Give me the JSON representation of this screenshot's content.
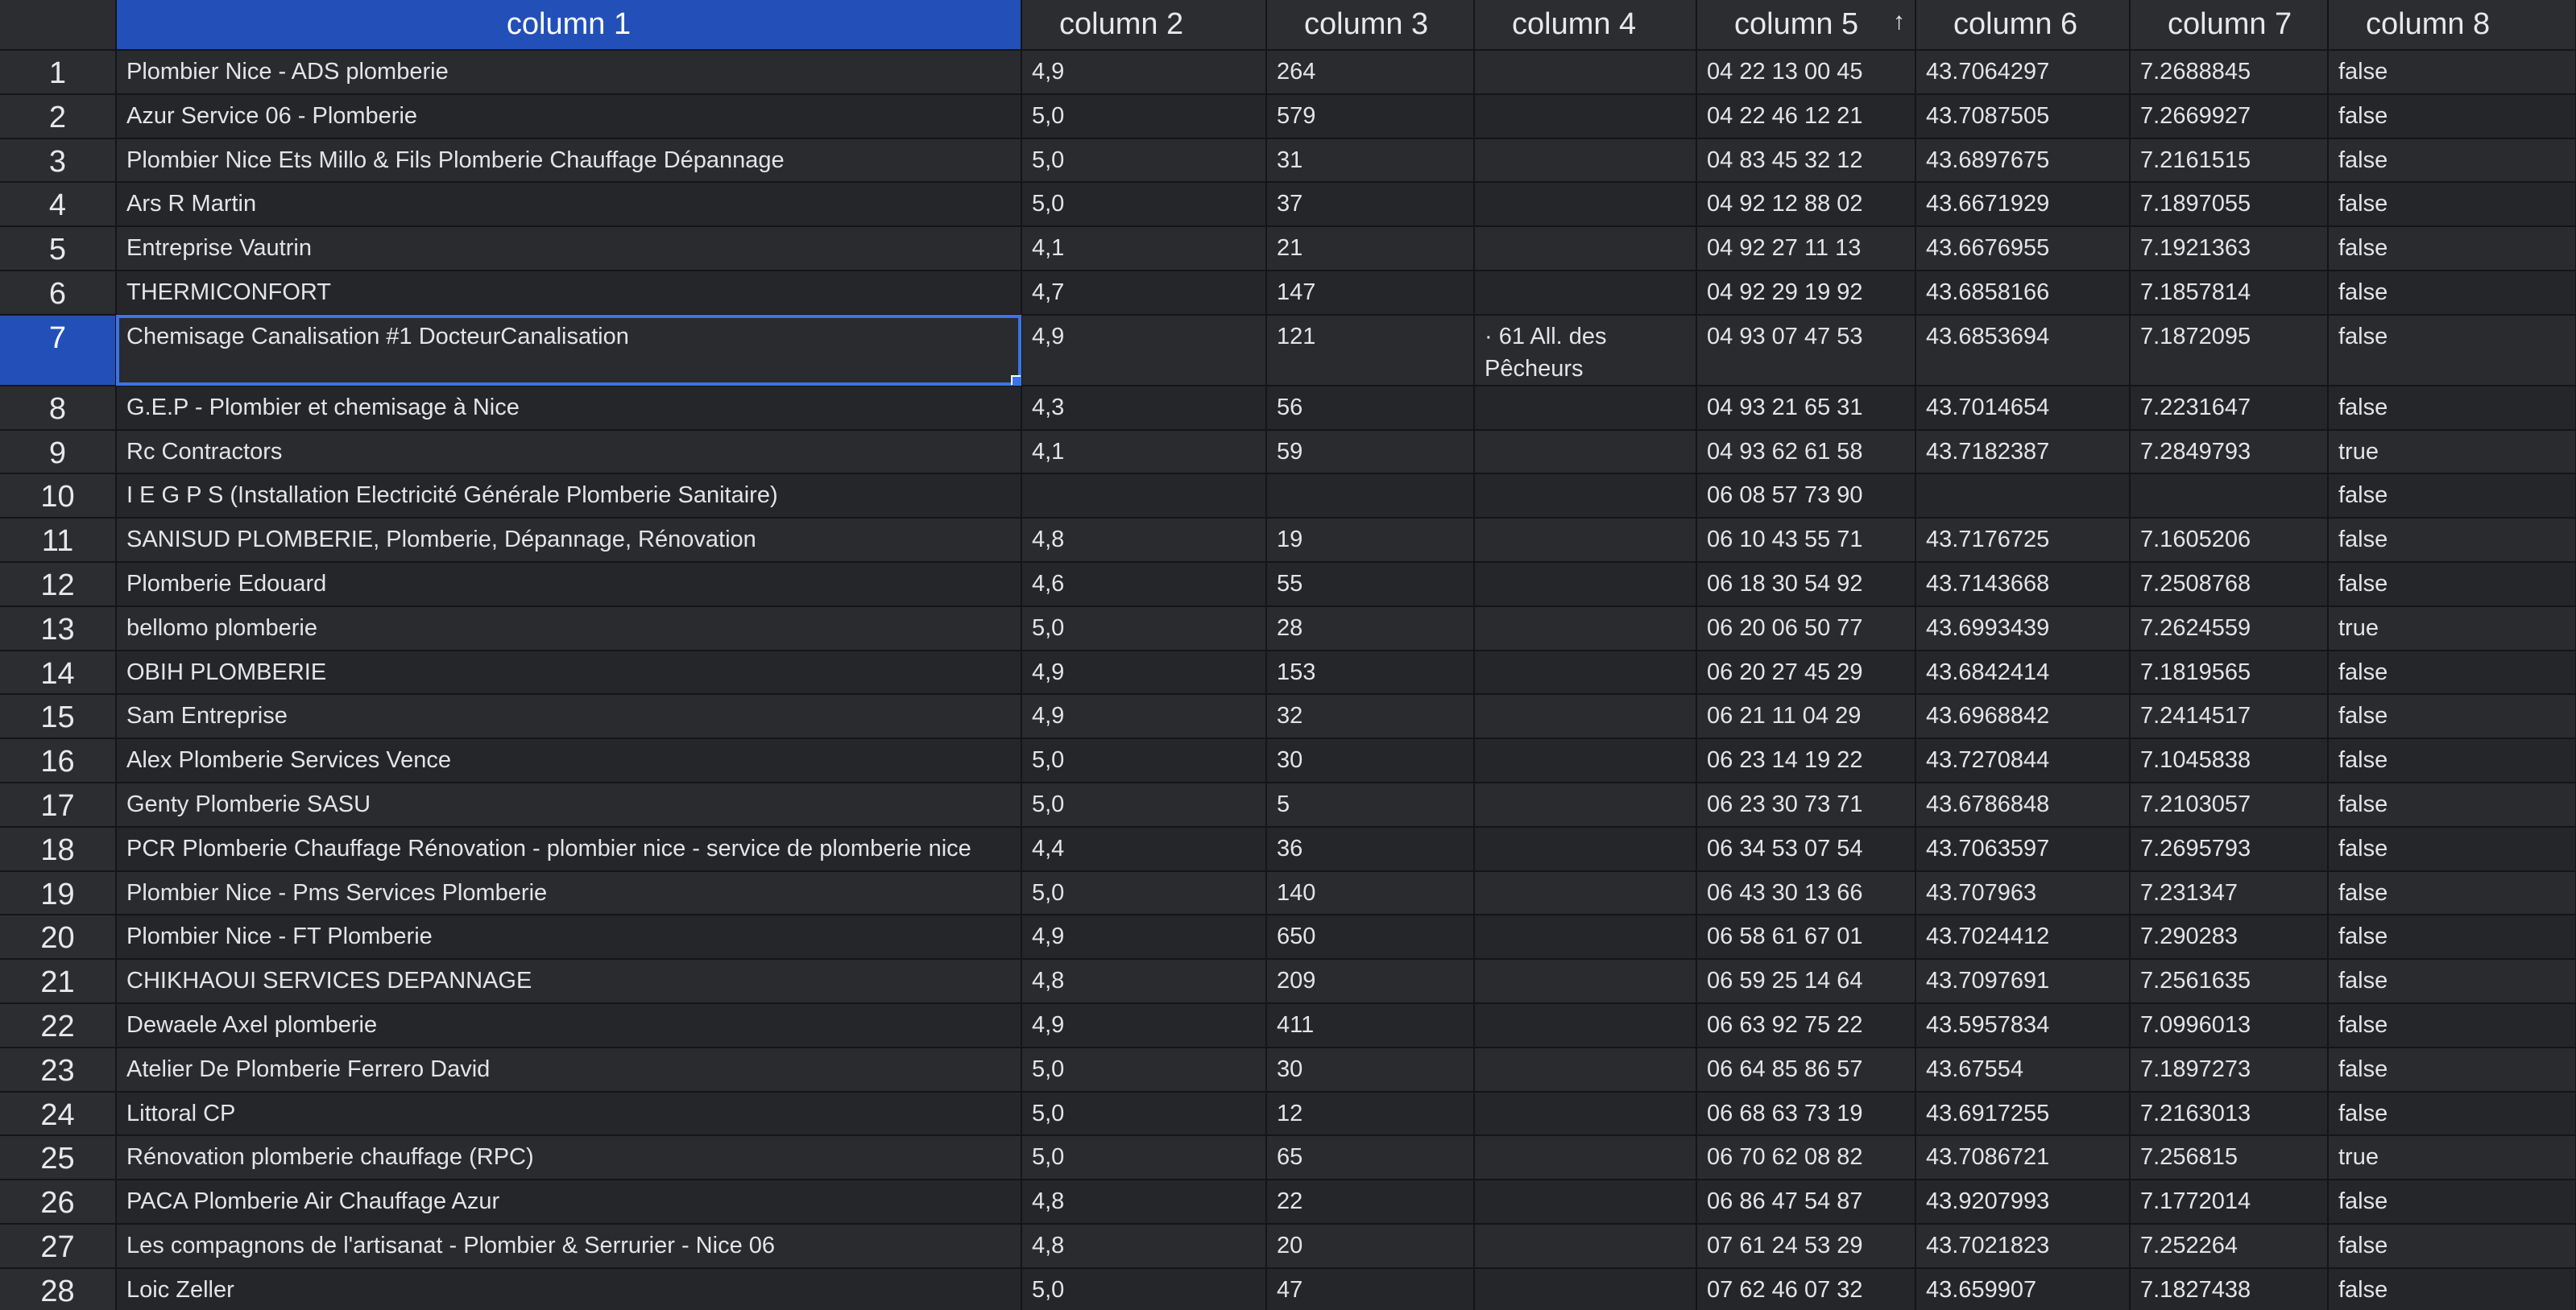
{
  "columns": [
    "column 1",
    "column 2",
    "column 3",
    "column 4",
    "column 5",
    "column 6",
    "column 7",
    "column 8"
  ],
  "sort": {
    "column_index": 4,
    "direction": "ascending",
    "icon": "sort-up-arrow-icon",
    "glyph": "↑"
  },
  "selected_column_index": 0,
  "selected_row_index": 6,
  "colors": {
    "accent": "#2350b8",
    "selection_border": "#3b74e8",
    "background": "#1e1f22"
  },
  "rows": [
    {
      "num": "1",
      "cells": [
        "Plombier Nice - ADS plomberie",
        "4,9",
        "264",
        "",
        "04 22 13 00 45",
        "43.7064297",
        "7.2688845",
        "false"
      ]
    },
    {
      "num": "2",
      "cells": [
        "Azur Service 06 - Plomberie",
        "5,0",
        "579",
        "",
        "04 22 46 12 21",
        "43.7087505",
        "7.2669927",
        "false"
      ]
    },
    {
      "num": "3",
      "cells": [
        "Plombier Nice Ets Millo & Fils Plomberie Chauffage Dépannage",
        "5,0",
        "31",
        "",
        "04 83 45 32 12",
        "43.6897675",
        "7.2161515",
        "false"
      ]
    },
    {
      "num": "4",
      "cells": [
        "Ars R Martin",
        "5,0",
        "37",
        "",
        "04 92 12 88 02",
        "43.6671929",
        "7.1897055",
        "false"
      ]
    },
    {
      "num": "5",
      "cells": [
        "Entreprise Vautrin",
        "4,1",
        "21",
        "",
        "04 92 27 11 13",
        "43.6676955",
        "7.1921363",
        "false"
      ]
    },
    {
      "num": "6",
      "cells": [
        "THERMICONFORT",
        "4,7",
        "147",
        "",
        "04 92 29 19 92",
        "43.6858166",
        "7.1857814",
        "false"
      ]
    },
    {
      "num": "7",
      "cells": [
        "Chemisage Canalisation #1 DocteurCanalisation",
        "4,9",
        "121",
        "· 61 All. des Pêcheurs",
        "04 93 07 47 53",
        "43.6853694",
        "7.1872095",
        "false"
      ]
    },
    {
      "num": "8",
      "cells": [
        "G.E.P - Plombier et chemisage à Nice",
        "4,3",
        "56",
        "",
        "04 93 21 65 31",
        "43.7014654",
        "7.2231647",
        "false"
      ]
    },
    {
      "num": "9",
      "cells": [
        "Rc Contractors",
        "4,1",
        "59",
        "",
        "04 93 62 61 58",
        "43.7182387",
        "7.2849793",
        "true"
      ]
    },
    {
      "num": "10",
      "cells": [
        "I E G P S (Installation Electricité Générale Plomberie Sanitaire)",
        "",
        "",
        "",
        "06 08 57 73 90",
        "",
        "",
        "false"
      ]
    },
    {
      "num": "11",
      "cells": [
        "SANISUD PLOMBERIE, Plomberie, Dépannage, Rénovation",
        "4,8",
        "19",
        "",
        "06 10 43 55 71",
        "43.7176725",
        "7.1605206",
        "false"
      ]
    },
    {
      "num": "12",
      "cells": [
        "Plomberie Edouard",
        "4,6",
        "55",
        "",
        "06 18 30 54 92",
        "43.7143668",
        "7.2508768",
        "false"
      ]
    },
    {
      "num": "13",
      "cells": [
        "bellomo plomberie",
        "5,0",
        "28",
        "",
        "06 20 06 50 77",
        "43.6993439",
        "7.2624559",
        "true"
      ]
    },
    {
      "num": "14",
      "cells": [
        "OBIH PLOMBERIE",
        "4,9",
        "153",
        "",
        "06 20 27 45 29",
        "43.6842414",
        "7.1819565",
        "false"
      ]
    },
    {
      "num": "15",
      "cells": [
        "Sam Entreprise",
        "4,9",
        "32",
        "",
        "06 21 11 04 29",
        "43.6968842",
        "7.2414517",
        "false"
      ]
    },
    {
      "num": "16",
      "cells": [
        "Alex Plomberie Services Vence",
        "5,0",
        "30",
        "",
        "06 23 14 19 22",
        "43.7270844",
        "7.1045838",
        "false"
      ]
    },
    {
      "num": "17",
      "cells": [
        "Genty Plomberie SASU",
        "5,0",
        "5",
        "",
        "06 23 30 73 71",
        "43.6786848",
        "7.2103057",
        "false"
      ]
    },
    {
      "num": "18",
      "cells": [
        "PCR Plomberie Chauffage Rénovation - plombier nice - service de plomberie nice",
        "4,4",
        "36",
        "",
        "06 34 53 07 54",
        "43.7063597",
        "7.2695793",
        "false"
      ]
    },
    {
      "num": "19",
      "cells": [
        "Plombier Nice - Pms Services Plomberie",
        "5,0",
        "140",
        "",
        "06 43 30 13 66",
        "43.707963",
        "7.231347",
        "false"
      ]
    },
    {
      "num": "20",
      "cells": [
        "Plombier Nice - FT Plomberie",
        "4,9",
        "650",
        "",
        "06 58 61 67 01",
        "43.7024412",
        "7.290283",
        "false"
      ]
    },
    {
      "num": "21",
      "cells": [
        "CHIKHAOUI SERVICES DEPANNAGE",
        "4,8",
        "209",
        "",
        "06 59 25 14 64",
        "43.7097691",
        "7.2561635",
        "false"
      ]
    },
    {
      "num": "22",
      "cells": [
        "Dewaele Axel plomberie",
        "4,9",
        "411",
        "",
        "06 63 92 75 22",
        "43.5957834",
        "7.0996013",
        "false"
      ]
    },
    {
      "num": "23",
      "cells": [
        "Atelier De Plomberie Ferrero David",
        "5,0",
        "30",
        "",
        "06 64 85 86 57",
        "43.67554",
        "7.1897273",
        "false"
      ]
    },
    {
      "num": "24",
      "cells": [
        "Littoral CP",
        "5,0",
        "12",
        "",
        "06 68 63 73 19",
        "43.6917255",
        "7.2163013",
        "false"
      ]
    },
    {
      "num": "25",
      "cells": [
        "Rénovation plomberie chauffage (RPC)",
        "5,0",
        "65",
        "",
        "06 70 62 08 82",
        "43.7086721",
        "7.256815",
        "true"
      ]
    },
    {
      "num": "26",
      "cells": [
        "PACA Plomberie Air Chauffage Azur",
        "4,8",
        "22",
        "",
        "06 86 47 54 87",
        "43.9207993",
        "7.1772014",
        "false"
      ]
    },
    {
      "num": "27",
      "cells": [
        "Les compagnons de l'artisanat - Plombier & Serrurier - Nice 06",
        "4,8",
        "20",
        "",
        "07 61 24 53 29",
        "43.7021823",
        "7.252264",
        "false"
      ]
    },
    {
      "num": "28",
      "cells": [
        "Loic Zeller",
        "5,0",
        "47",
        "",
        "07 62 46 07 32",
        "43.659907",
        "7.1827438",
        "false"
      ]
    }
  ]
}
